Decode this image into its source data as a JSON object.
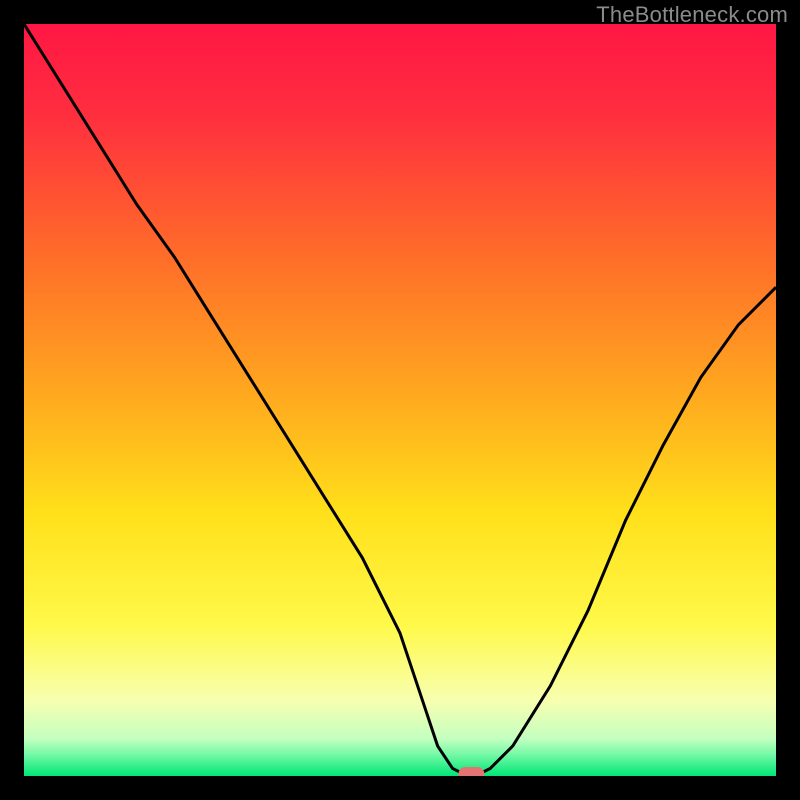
{
  "watermark": "TheBottleneck.com",
  "chart_data": {
    "type": "line",
    "title": "",
    "xlabel": "",
    "ylabel": "",
    "xlim": [
      0,
      100
    ],
    "ylim": [
      0,
      100
    ],
    "grid": false,
    "legend": false,
    "series": [
      {
        "name": "bottleneck-curve",
        "x": [
          0,
          5,
          10,
          15,
          20,
          25,
          30,
          35,
          40,
          45,
          50,
          53,
          55,
          57,
          59,
          60,
          62,
          65,
          70,
          75,
          80,
          85,
          90,
          95,
          100
        ],
        "y": [
          100,
          92,
          84,
          76,
          69,
          61,
          53,
          45,
          37,
          29,
          19,
          10,
          4,
          1,
          0,
          0,
          1,
          4,
          12,
          22,
          34,
          44,
          53,
          60,
          65
        ]
      }
    ],
    "optimal_marker": {
      "x": 59.5,
      "y": 0
    },
    "gradient_stops": [
      {
        "offset": 0.0,
        "color": "#ff1744"
      },
      {
        "offset": 0.12,
        "color": "#ff2e3f"
      },
      {
        "offset": 0.3,
        "color": "#ff6a2a"
      },
      {
        "offset": 0.5,
        "color": "#ffab1e"
      },
      {
        "offset": 0.65,
        "color": "#ffe01a"
      },
      {
        "offset": 0.8,
        "color": "#fff94a"
      },
      {
        "offset": 0.9,
        "color": "#f7ffb0"
      },
      {
        "offset": 0.95,
        "color": "#c4ffc0"
      },
      {
        "offset": 0.97,
        "color": "#7afaa8"
      },
      {
        "offset": 1.0,
        "color": "#00e676"
      }
    ],
    "marker_color": "#e57373"
  }
}
